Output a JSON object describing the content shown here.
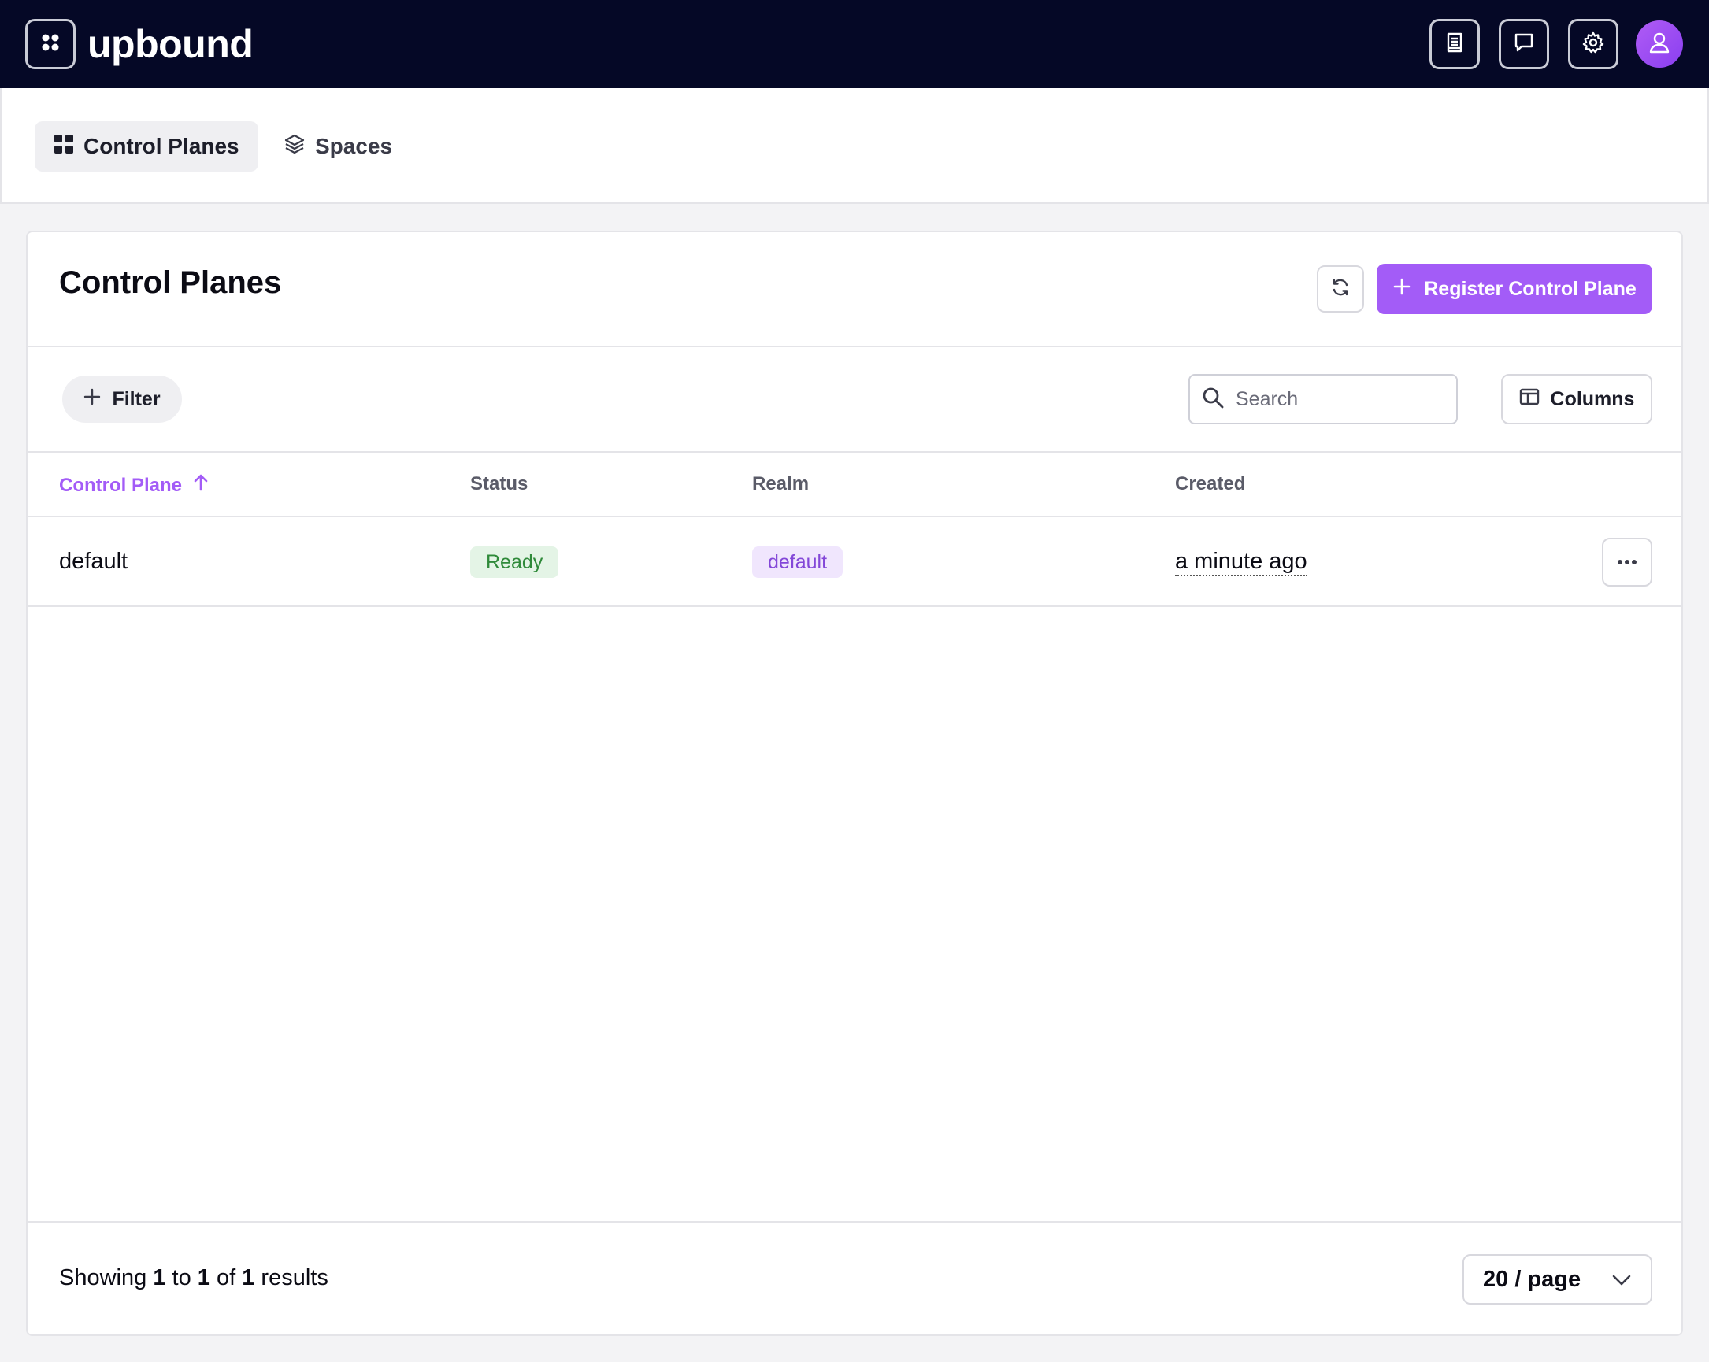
{
  "app": {
    "brand": "upbound",
    "top_icons": [
      "book-icon",
      "chat-icon",
      "gear-icon",
      "user-icon"
    ]
  },
  "subnav": {
    "tabs": [
      {
        "label": "Control Planes",
        "icon": "grid-icon",
        "active": true
      },
      {
        "label": "Spaces",
        "icon": "layers-icon",
        "active": false
      }
    ]
  },
  "page": {
    "title": "Control Planes",
    "register_label": "Register Control Plane",
    "filter_label": "Filter",
    "search_placeholder": "Search",
    "columns_label": "Columns"
  },
  "table": {
    "headers": {
      "control_plane": "Control Plane",
      "status": "Status",
      "realm": "Realm",
      "created": "Created"
    },
    "sort": {
      "column": "Control Plane",
      "direction": "ascending"
    },
    "rows": [
      {
        "name": "default",
        "status": "Ready",
        "realm": "default",
        "created": "a minute ago"
      }
    ]
  },
  "footer": {
    "showing_prefix": "Showing",
    "from": "1",
    "to_word": "to",
    "to": "1",
    "of_word": "of",
    "total": "1",
    "results_word": "results",
    "per_page": "20 / page"
  },
  "colors": {
    "topbar": "#050826",
    "accent": "#a35cf7",
    "ready_bg": "#e4f4e6",
    "ready_text": "#2f8a3a",
    "realm_bg": "#f0e6fd",
    "realm_text": "#8347d8"
  }
}
